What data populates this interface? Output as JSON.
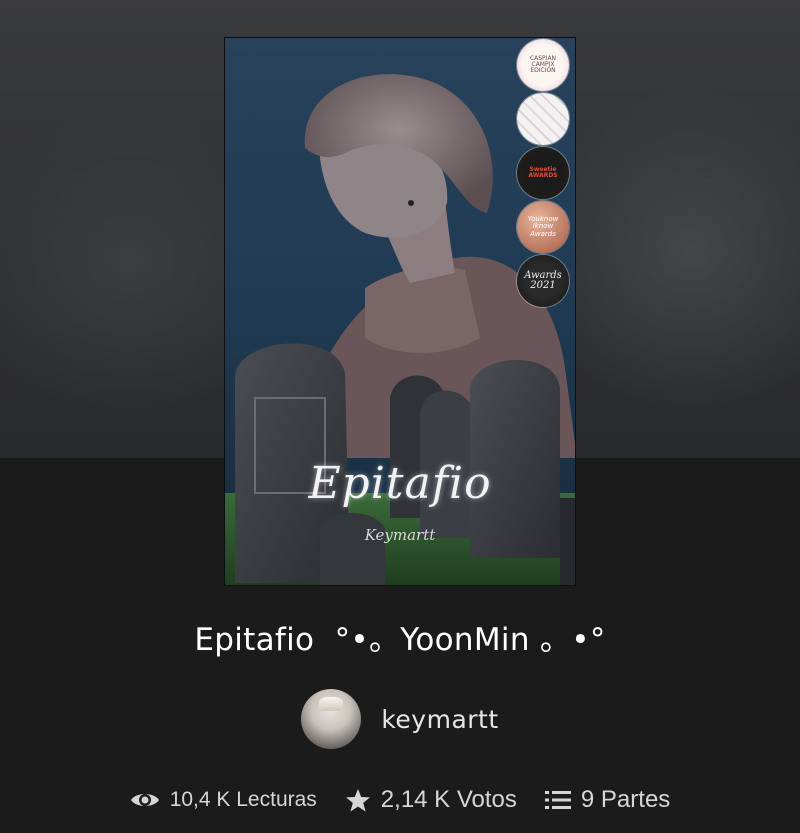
{
  "story": {
    "title": "Epitafio  °•。YoonMin 。•°",
    "cover_title": "Epitafio",
    "cover_signature": "Keymartt"
  },
  "author": {
    "name": "keymartt"
  },
  "badges": [
    "CASPIAN CAMPIX EDICIÓN",
    "",
    "Sweetie AWARDS",
    "Youknow Iknow Awards",
    "Awards 2021"
  ],
  "stats": {
    "reads": "10,4 K Lecturas",
    "votes": "2,14 K Votos",
    "parts": "9 Partes"
  },
  "icons": [
    "eye-icon",
    "star-icon",
    "list-icon"
  ],
  "colors": {
    "background": "#1b1b1c",
    "hero": "#2e2f32",
    "text": "#ffffff"
  }
}
